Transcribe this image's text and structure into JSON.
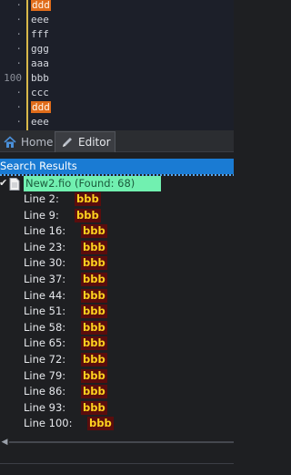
{
  "editor": {
    "lines": [
      {
        "num": "·",
        "text": "ddd",
        "highlight": true
      },
      {
        "num": "·",
        "text": "eee",
        "highlight": false
      },
      {
        "num": "·",
        "text": "fff",
        "highlight": false
      },
      {
        "num": "·",
        "text": "ggg",
        "highlight": false
      },
      {
        "num": "·",
        "text": "aaa",
        "highlight": false
      },
      {
        "num": "100",
        "text": "bbb",
        "highlight": false
      },
      {
        "num": "·",
        "text": "ccc",
        "highlight": false
      },
      {
        "num": "·",
        "text": "ddd",
        "highlight": true
      },
      {
        "num": "·",
        "text": "eee",
        "highlight": false
      },
      {
        "num": "·",
        "text": "fff",
        "highlight": false
      }
    ]
  },
  "tabs": {
    "home_label": "Home",
    "editor_label": "Editor"
  },
  "search_panel": {
    "title": "Search Results",
    "file_label": "New2.fio (Found: 68)",
    "results": [
      {
        "line": "Line 2:",
        "match": "bbb"
      },
      {
        "line": "Line 9:",
        "match": "bbb"
      },
      {
        "line": "Line 16:",
        "match": "bbb"
      },
      {
        "line": "Line 23:",
        "match": "bbb"
      },
      {
        "line": "Line 30:",
        "match": "bbb"
      },
      {
        "line": "Line 37:",
        "match": "bbb"
      },
      {
        "line": "Line 44:",
        "match": "bbb"
      },
      {
        "line": "Line 51:",
        "match": "bbb"
      },
      {
        "line": "Line 58:",
        "match": "bbb"
      },
      {
        "line": "Line 65:",
        "match": "bbb"
      },
      {
        "line": "Line 72:",
        "match": "bbb"
      },
      {
        "line": "Line 79:",
        "match": "bbb"
      },
      {
        "line": "Line 86:",
        "match": "bbb"
      },
      {
        "line": "Line 93:",
        "match": "bbb"
      },
      {
        "line": "Line 100:",
        "match": "bbb"
      }
    ]
  },
  "colors": {
    "accent": "#1a7bd3",
    "match_highlight": "#e06c1a",
    "file_highlight": "#71f0b0",
    "result_match_bg": "#5a0d0d",
    "result_match_text": "#ffd21f"
  }
}
